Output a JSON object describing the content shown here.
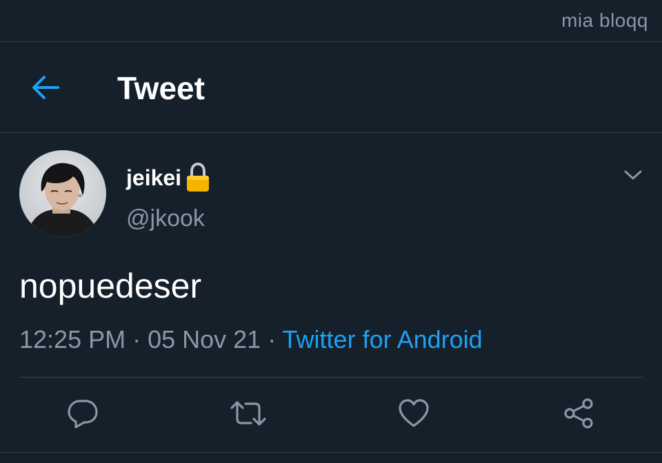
{
  "watermark": "mia bloqq",
  "header": {
    "back_icon": "arrow-left-icon",
    "title": "Tweet"
  },
  "tweet": {
    "author": {
      "display_name": "jeikei",
      "protected_icon": "lock-icon",
      "handle": "@jkook"
    },
    "menu_icon": "chevron-down-icon",
    "text": "nopuedeser",
    "time": "12:25 PM",
    "separator": " · ",
    "date": "05 Nov 21",
    "source": "Twitter for Android"
  },
  "actions": [
    {
      "name": "reply",
      "icon": "reply-icon"
    },
    {
      "name": "retweet",
      "icon": "retweet-icon"
    },
    {
      "name": "like",
      "icon": "heart-icon"
    },
    {
      "name": "share",
      "icon": "share-icon"
    }
  ],
  "colors": {
    "background": "#15202b",
    "accent": "#1da1f2",
    "secondary_text": "#8899a6",
    "border": "#38444d",
    "lock": "#f5b400"
  }
}
